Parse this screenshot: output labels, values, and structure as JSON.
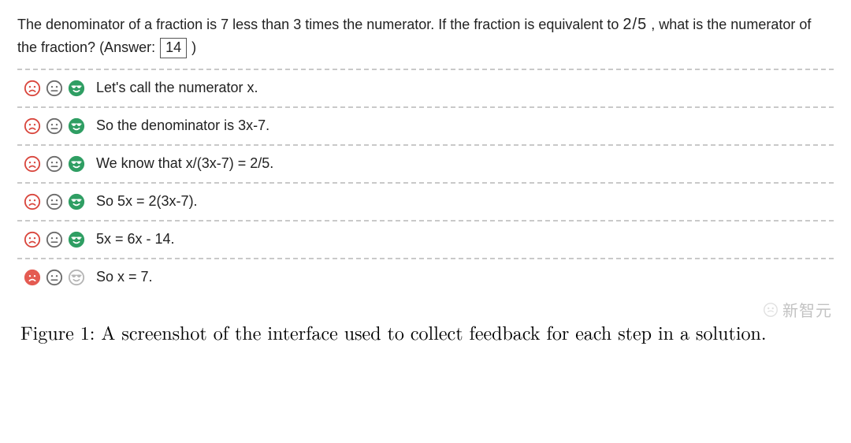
{
  "question": {
    "part1": "The denominator of a fraction is 7 less than 3 times the numerator. If the fraction is equivalent to ",
    "fraction": "2/5",
    "part2": ", what is the numerator of the fraction? (Answer: ",
    "answer_value": "14",
    "part3": ")"
  },
  "icons": {
    "frown": "frown-icon",
    "meh": "meh-icon",
    "cool": "cool-icon"
  },
  "colors": {
    "red_stroke": "#d9463d",
    "red_fill": "#e45b52",
    "gray_stroke": "#6b6b6b",
    "green_fill": "#2f9e63",
    "green_stroke": "#2f9e63",
    "light_gray_stroke": "#b5b5b5"
  },
  "steps": [
    {
      "text": "Let's call the numerator x.",
      "selected": "cool"
    },
    {
      "text": "So the denominator is 3x-7.",
      "selected": "cool"
    },
    {
      "text": "We know that x/(3x-7) = 2/5.",
      "selected": "cool"
    },
    {
      "text": "So 5x = 2(3x-7).",
      "selected": "cool"
    },
    {
      "text": "5x = 6x - 14.",
      "selected": "cool"
    },
    {
      "text": "So x = 7.",
      "selected": "frown"
    }
  ],
  "caption": "Figure 1: A screenshot of the interface used to collect feedback for each step in a solution.",
  "watermark": "新智元"
}
